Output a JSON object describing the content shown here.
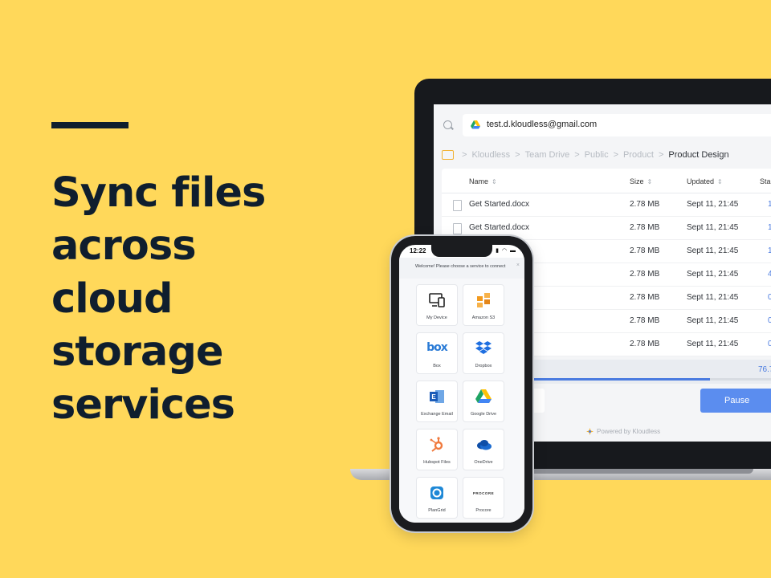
{
  "hero": {
    "headline": [
      "Sync files",
      "across",
      "cloud",
      "storage",
      "services"
    ]
  },
  "desktop": {
    "account_email": "test.d.kloudless@gmail.com",
    "breadcrumbs": [
      "Kloudless",
      "Team Drive",
      "Public",
      "Product",
      "Product Design"
    ],
    "breadcrumb_separator": ">",
    "columns": [
      "Name",
      "Size",
      "Updated",
      "Sta"
    ],
    "rows": [
      {
        "name": "Get Started.docx",
        "size": "2.78 MB",
        "updated": "Sept 11, 21:45",
        "status": "1"
      },
      {
        "name": "Get Started.docx",
        "size": "2.78 MB",
        "updated": "Sept 11, 21:45",
        "status": "1"
      },
      {
        "name": "",
        "size": "2.78 MB",
        "updated": "Sept 11, 21:45",
        "status": "1"
      },
      {
        "name": "",
        "size": "2.78 MB",
        "updated": "Sept 11, 21:45",
        "status": "4"
      },
      {
        "name": "",
        "size": "2.78 MB",
        "updated": "Sept 11, 21:45",
        "status": "0"
      },
      {
        "name": "",
        "size": "2.78 MB",
        "updated": "Sept 11, 21:45",
        "status": "0"
      },
      {
        "name": "",
        "size": "2.78 MB",
        "updated": "Sept 11, 21:45",
        "status": "0"
      }
    ],
    "progress_label": "76.7",
    "progress_fraction": 0.82,
    "pause_label": "Pause",
    "powered_by": "Powered by Kloudless"
  },
  "phone": {
    "time": "12:22",
    "status_icons": "▮ ◠ ▬",
    "welcome": "Welcome! Please choose a service to connect",
    "close": "×",
    "services": [
      {
        "label": "My Device",
        "icon": "device-icon"
      },
      {
        "label": "Amazon S3",
        "icon": "amazon-s3-icon"
      },
      {
        "label": "Box",
        "icon": "box-icon",
        "wordmark": "box"
      },
      {
        "label": "Dropbox",
        "icon": "dropbox-icon"
      },
      {
        "label": "Exchange Email",
        "icon": "exchange-icon"
      },
      {
        "label": "Google Drive",
        "icon": "google-drive-icon"
      },
      {
        "label": "Hubspot Files",
        "icon": "hubspot-icon"
      },
      {
        "label": "OneDrive",
        "icon": "onedrive-icon"
      },
      {
        "label": "PlanGrid",
        "icon": "plangrid-icon"
      },
      {
        "label": "Procore",
        "icon": "procore-icon",
        "wordmark": "PROCORE"
      }
    ]
  },
  "colors": {
    "background": "#FFD85A",
    "headline": "#0F1E2E",
    "accent_blue": "#4A7BE0",
    "pause_button": "#5B8DEF"
  }
}
